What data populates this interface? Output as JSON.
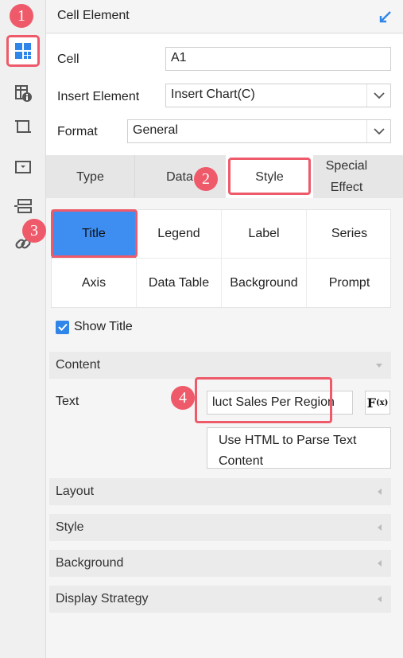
{
  "rail": {
    "items": [
      {
        "icon": "cell-element-icon",
        "active": true
      },
      {
        "icon": "cell-attribute-icon",
        "active": false
      },
      {
        "icon": "float-element-icon",
        "active": false
      },
      {
        "icon": "widget-icon",
        "active": false
      },
      {
        "icon": "report-block-icon",
        "active": false
      },
      {
        "icon": "hyperlink-icon",
        "active": false
      }
    ]
  },
  "header": {
    "title": "Cell Element",
    "collapse_icon": "collapse-arrow-icon"
  },
  "form": {
    "cell_label": "Cell",
    "cell_value": "A1",
    "insert_label": "Insert Element",
    "insert_value": "Insert Chart(C)",
    "format_label": "Format",
    "format_value": "General"
  },
  "tabs": [
    {
      "label": "Type",
      "active": false
    },
    {
      "label": "Data",
      "active": false
    },
    {
      "label": "Style",
      "active": true
    },
    {
      "label": "Special Effect",
      "active": false
    }
  ],
  "style_tabs": [
    {
      "label": "Title",
      "selected": true
    },
    {
      "label": "Legend",
      "selected": false
    },
    {
      "label": "Label",
      "selected": false
    },
    {
      "label": "Series",
      "selected": false
    },
    {
      "label": "Axis",
      "selected": false
    },
    {
      "label": "Data Table",
      "selected": false
    },
    {
      "label": "Background",
      "selected": false
    },
    {
      "label": "Prompt",
      "selected": false
    }
  ],
  "show_title": {
    "label": "Show Title",
    "checked": true
  },
  "content": {
    "section_label": "Content",
    "text_label": "Text",
    "text_value": "luct Sales Per Region",
    "fx_label": "F",
    "fx_sub": "(x)",
    "html_button": "Use HTML to Parse Text Content"
  },
  "sections": [
    "Layout",
    "Style",
    "Background",
    "Display Strategy"
  ],
  "annotations": [
    "1",
    "2",
    "3",
    "4"
  ],
  "colors": {
    "accent": "#3d8ef0",
    "highlight": "#ee5a6a",
    "checkbox": "#2f86e8"
  }
}
